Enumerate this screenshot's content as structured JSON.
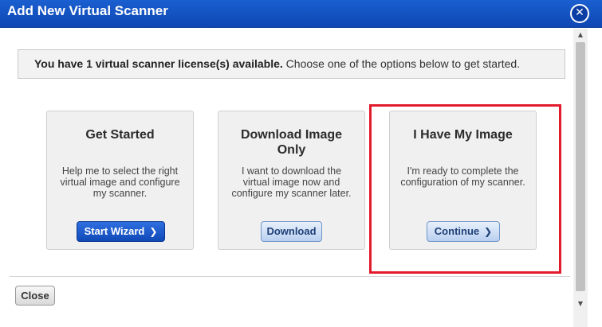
{
  "dialog": {
    "title": "Add New Virtual Scanner",
    "close_icon_glyph": "✕"
  },
  "license": {
    "bold_text": "You have 1 virtual scanner license(s) available.",
    "rest_text": " Choose one of the options below to get started."
  },
  "cards": [
    {
      "title_line1": "Get Started",
      "title_line2": "",
      "desc_line1": "Help me to select the right",
      "desc_line2": "virtual image and configure",
      "desc_line3": "my scanner.",
      "button_label": "Start Wizard",
      "button_chevron": "❯"
    },
    {
      "title_line1": "Download Image",
      "title_line2": "Only",
      "desc_line1": "I want to download the",
      "desc_line2": "virtual image now and",
      "desc_line3": "configure my scanner later.",
      "button_label": "Download",
      "button_chevron": ""
    },
    {
      "title_line1": "I Have My Image",
      "title_line2": "",
      "desc_line1": "I'm ready to complete the",
      "desc_line2": "configuration of my scanner.",
      "desc_line3": "",
      "button_label": "Continue",
      "button_chevron": "❯"
    }
  ],
  "footer": {
    "close_label": "Close"
  },
  "scrollbar": {
    "up_arrow": "▲",
    "down_arrow": "▼"
  },
  "colors": {
    "titlebar": "#1a5fd0",
    "highlight": "#e21b2c",
    "primary_button": "#1049b8",
    "secondary_button": "#b9d0f0"
  },
  "icons": {
    "close": "close-icon",
    "chevron": "chevron-right-icon"
  }
}
